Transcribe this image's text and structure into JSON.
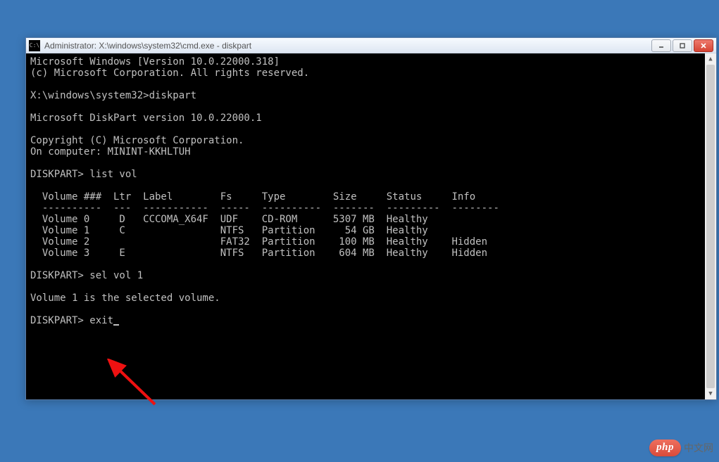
{
  "window": {
    "title": "Administrator: X:\\windows\\system32\\cmd.exe - diskpart"
  },
  "console": {
    "header1": "Microsoft Windows [Version 10.0.22000.318]",
    "header2": "(c) Microsoft Corporation. All rights reserved.",
    "prompt1": "X:\\windows\\system32>diskpart",
    "dp_version": "Microsoft DiskPart version 10.0.22000.1",
    "copyright": "Copyright (C) Microsoft Corporation.",
    "computer": "On computer: MININT-KKHLTUH",
    "cmd_listvol_prompt": "DISKPART> list vol",
    "table_header": "  Volume ###  Ltr  Label        Fs     Type        Size     Status     Info",
    "table_divider": "  ----------  ---  -----------  -----  ----------  -------  ---------  --------",
    "volumes": [
      "  Volume 0     D   CCCOMA_X64F  UDF    CD-ROM      5307 MB  Healthy",
      "  Volume 1     C                NTFS   Partition     54 GB  Healthy",
      "  Volume 2                      FAT32  Partition    100 MB  Healthy    Hidden",
      "  Volume 3     E                NTFS   Partition    604 MB  Healthy    Hidden"
    ],
    "cmd_selvol_prompt": "DISKPART> sel vol 1",
    "selvol_result": "Volume 1 is the selected volume.",
    "cmd_exit_prompt": "DISKPART> exit"
  },
  "watermark": {
    "badge": "php",
    "text": "中文网"
  }
}
